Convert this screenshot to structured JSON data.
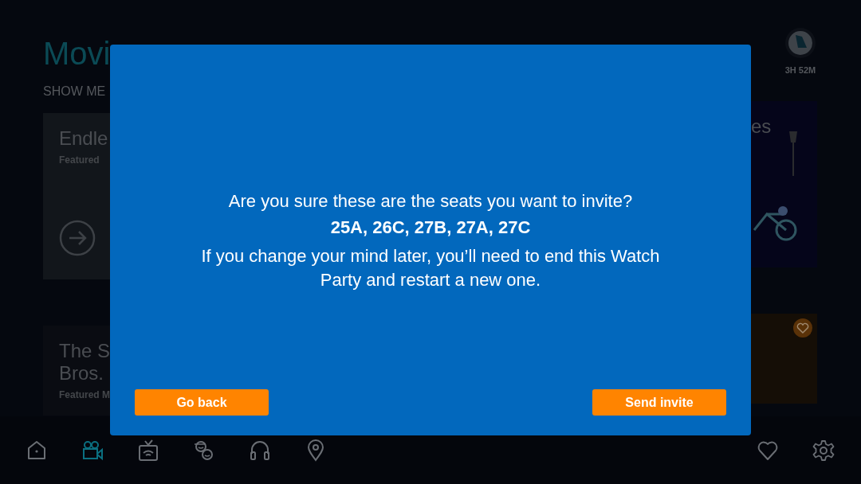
{
  "header": {
    "tab": {
      "label": "Movi",
      "selected": true
    },
    "filter_label": "SHOW ME",
    "flight_time": "3H 52M"
  },
  "cards_left": [
    {
      "title": "Endle",
      "subtitle": "Featured",
      "kind": "collection"
    },
    {
      "title": "The S",
      "title_line_2": "Bros.",
      "subtitle": "Featured M",
      "kind": "movie"
    }
  ],
  "cards_right": [
    {
      "title": "es",
      "kind": "collection"
    },
    {
      "kind": "movie",
      "favorite": false
    }
  ],
  "dialog": {
    "question": "Are you sure these are the seats you want to invite?",
    "seats": "25A, 26C, 27B, 27A, 27C",
    "warning": "If you change your mind later, you’ll need to end this Watch Party and restart a new one.",
    "buttons": [
      {
        "label": "Go back"
      },
      {
        "label": "Send invite"
      }
    ]
  },
  "nav": [
    {
      "kind": "home",
      "selected": false
    },
    {
      "kind": "movies",
      "selected": true
    },
    {
      "kind": "tv",
      "selected": false
    },
    {
      "kind": "kids",
      "selected": false
    },
    {
      "kind": "audio",
      "selected": false
    },
    {
      "kind": "map",
      "selected": false
    },
    {
      "kind": "favorites",
      "selected": false
    },
    {
      "kind": "settings",
      "selected": false
    }
  ]
}
